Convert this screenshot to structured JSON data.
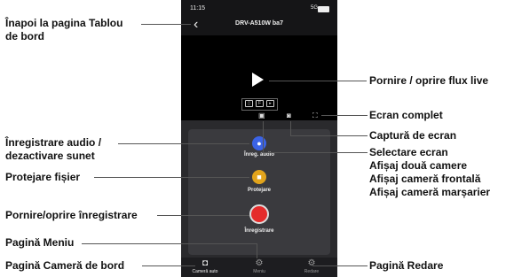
{
  "phone": {
    "status_time": "11:15",
    "status_signal": "5G",
    "device_name": "DRV-A510W ba7",
    "actions": {
      "audio_label": "Înreg. audio",
      "protect_label": "Protejare",
      "record_label": "Înregistrare"
    },
    "tabs": [
      {
        "label": "Cameră auto"
      },
      {
        "label": "Meniu"
      },
      {
        "label": "Redare"
      }
    ]
  },
  "callouts": {
    "back_line1": "Înapoi la pagina Tablou",
    "back_line2": "de bord",
    "audio_line1": "Înregistrare audio /",
    "audio_line2": "dezactivare sunet",
    "protect": "Protejare fișier",
    "record": "Pornire/oprire înregistrare",
    "menu": "Pagină Meniu",
    "dashcam": "Pagină Cameră de bord",
    "live": "Pornire / oprire flux live",
    "fullscreen": "Ecran complet",
    "screenshot": "Captură de ecran",
    "screen_select_1": "Selectare ecran",
    "screen_select_2": "Afișaj două camere",
    "screen_select_3": "Afișaj cameră frontală",
    "screen_select_4": "Afișaj cameră marșarier",
    "playback": "Pagină Redare"
  },
  "colors": {
    "audio_button": "#3b63e6",
    "protect_button": "#e2a41c",
    "record_button": "#e52b2b"
  }
}
